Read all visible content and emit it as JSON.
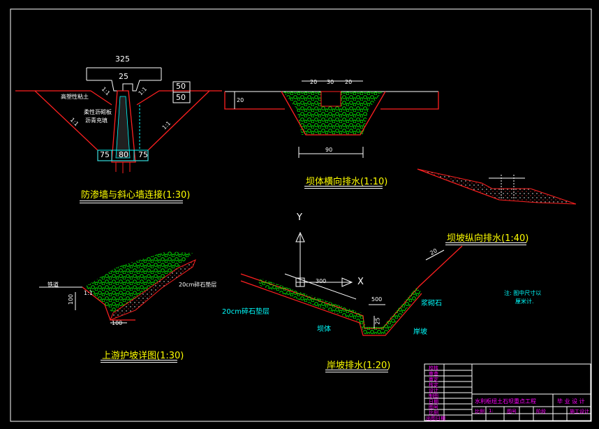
{
  "titles": {
    "impervious": "防渗墙与斜心墙连接(1:30)",
    "transverse": "坝体横向排水(1:10)",
    "longitudinal": "坝坡纵向排水(1:40)",
    "upstream": "上游护坡详图(1:30)",
    "bank": "岸坡排水(1:20)"
  },
  "labels": {
    "high_plastic_clay": "高塑性粘土",
    "flexible_asphalt_line1": "柔性沥砌板",
    "flexible_asphalt_line2": "沥青充填",
    "gravel_20cm_a": "20cm碎石垫层",
    "gravel_20cm_b": "20cm碎石垫层",
    "dam_body": "坝体",
    "bank_slope": "岸坡",
    "mortar_stone": "浆砌石",
    "flat": "铁道",
    "note_line1": "注: 图中尺寸以",
    "note_line2": "厘米计."
  },
  "dims": {
    "d325": "325",
    "d25": "25",
    "d50a": "50",
    "d50b": "50",
    "d75a": "75",
    "d80": "80",
    "d75b": "75",
    "s11a": "1:1",
    "s11b": "1:1",
    "s11c": "1:1",
    "s11d": "1:1",
    "s11e": "1:1",
    "t20a": "20",
    "t30": "30",
    "t20b": "20",
    "t20c": "20",
    "t90": "90",
    "u100": "100",
    "u100b": "100",
    "b300": "300",
    "b500": "500",
    "b25": "25",
    "b20": "20"
  },
  "axes": {
    "y": "Y",
    "x": "X"
  },
  "title_block": {
    "left_labels": [
      "校核",
      "审查",
      "审定",
      "核定",
      "设计",
      "制图",
      "日期",
      "图号",
      "比例",
      "出图日期"
    ],
    "project": "水利枢纽土石坝重点工程",
    "thesis": "毕 业 设 计",
    "bottom": [
      "比例",
      "1:",
      "图号",
      "阶段",
      "施工设计"
    ]
  }
}
